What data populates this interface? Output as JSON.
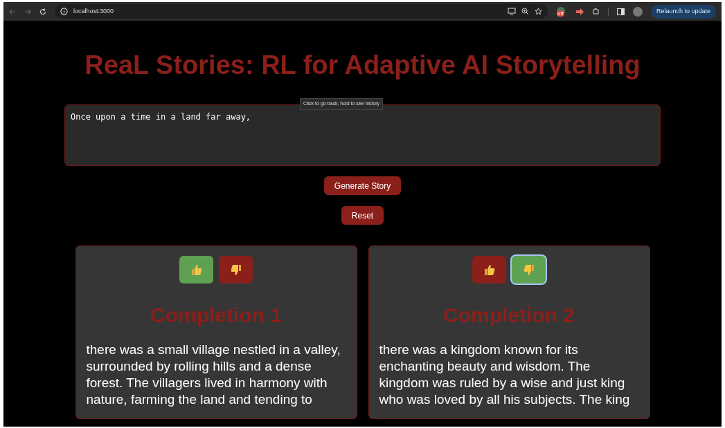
{
  "browser": {
    "url": "localhost:3000",
    "extension_badge": "off",
    "update_button": "Relaunch to update",
    "tooltip": "Click to go back, hold to see history"
  },
  "title": "ReaL Stories: RL for Adaptive AI Storytelling",
  "prompt": {
    "value": "Once upon a time in a land far away,"
  },
  "buttons": [
    "Generate Story",
    "Reset"
  ],
  "completions": [
    {
      "heading": "Completion 1",
      "feedback": [
        {
          "kind": "up",
          "selected": true,
          "focused": false
        },
        {
          "kind": "down",
          "selected": false,
          "focused": false
        }
      ],
      "text": "there was a small village nestled in a valley, surrounded by rolling hills and a dense forest. The villagers lived in harmony with nature, farming the land and tending to"
    },
    {
      "heading": "Completion 2",
      "feedback": [
        {
          "kind": "up",
          "selected": false,
          "focused": false
        },
        {
          "kind": "down",
          "selected": true,
          "focused": true
        }
      ],
      "text": "there was a kingdom known for its enchanting beauty and wisdom. The kingdom was ruled by a wise and just king who was loved by all his subjects. The king"
    }
  ]
}
